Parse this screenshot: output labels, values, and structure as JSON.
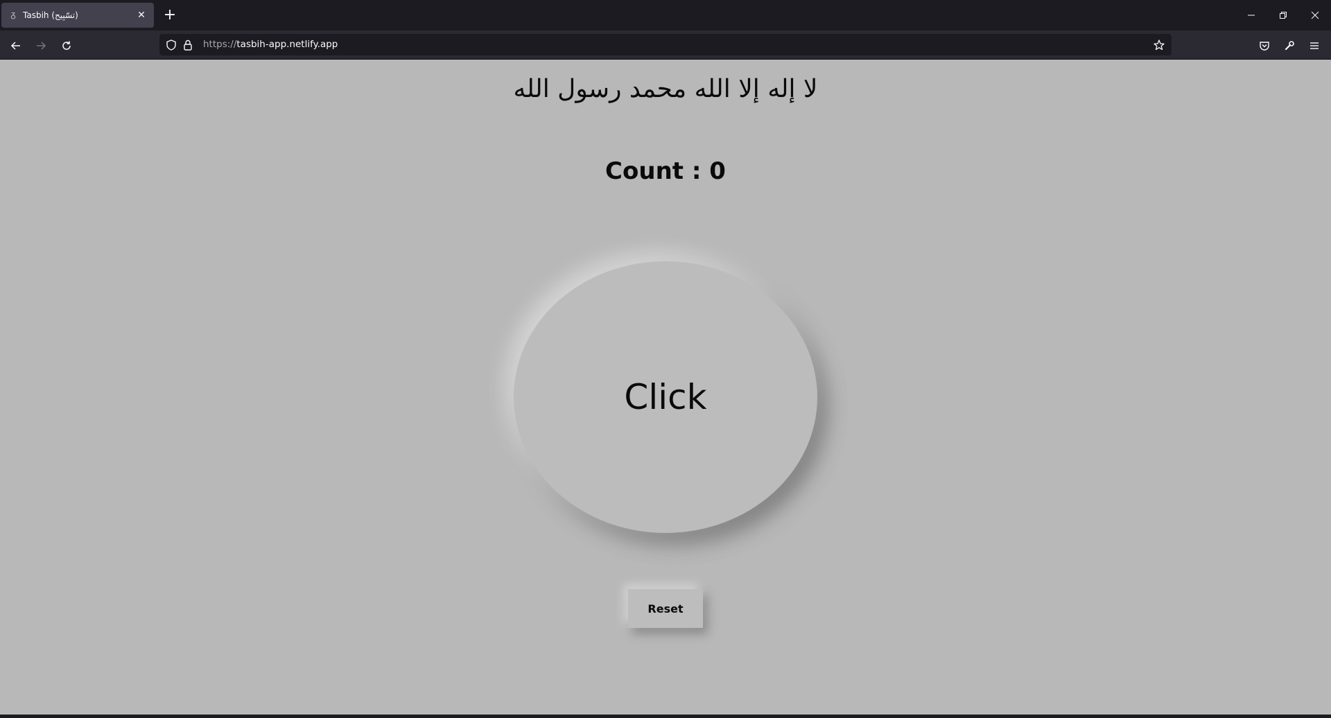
{
  "browser": {
    "tab": {
      "title": "Tasbih (تسّبِيح)",
      "favicon": "tasbih-bead-icon"
    },
    "new_tab_label": "+",
    "url": {
      "scheme": "https://",
      "host": "tasbih-app.netlify.app"
    },
    "icons": {
      "back": "arrow-left-icon",
      "forward": "arrow-right-icon",
      "reload": "reload-icon",
      "shield": "shield-icon",
      "lock": "lock-icon",
      "bookmark": "star-icon",
      "pocket": "pocket-icon",
      "tools": "wrench-icon",
      "menu": "hamburger-menu-icon",
      "minimize": "minimize-icon",
      "restore": "restore-icon",
      "close": "close-icon"
    }
  },
  "page": {
    "kalima": "لا إله إلا الله محمد رسول الله",
    "count_label": "Count : 0",
    "count_value": 0,
    "click_label": "Click",
    "reset_label": "Reset"
  },
  "colors": {
    "page_background": "#b8b8b8",
    "tabbar_background": "#1c1b22",
    "navbar_background": "#2b2a33",
    "text": "#0a0a0a"
  }
}
